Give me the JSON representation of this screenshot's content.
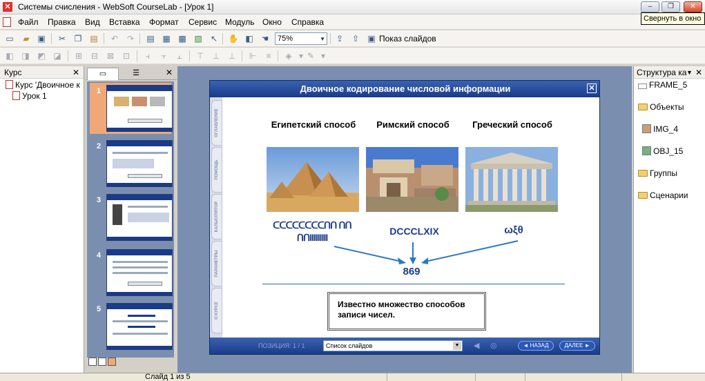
{
  "window": {
    "title": "Системы счисления - WebSoft CourseLab - [Урок 1]",
    "minimize": "–",
    "restore": "❐",
    "close": "✕",
    "tooltip": "Свернуть в окно"
  },
  "menu": [
    "Файл",
    "Правка",
    "Вид",
    "Вставка",
    "Формат",
    "Сервис",
    "Модуль",
    "Окно",
    "Справка"
  ],
  "toolbar": {
    "zoom": "75%",
    "show_slides": "Показ слайдов"
  },
  "course_panel": {
    "title": "Курс",
    "tree": [
      "Курс 'Двоичное к",
      "Урок 1"
    ]
  },
  "slides_panel": {
    "slides": [
      "1",
      "2",
      "3",
      "4",
      "5"
    ]
  },
  "slide": {
    "title": "Двоичное кодирование числовой информации",
    "side_tabs": [
      "ОГЛАВЛЕНИЕ",
      "ПОМОЩЬ",
      "КАЛЬКУЛЯТОР",
      "ПАРАМЕТРЫ",
      "О КУРСЕ"
    ],
    "columns": [
      {
        "heading": "Египетский способ",
        "numeral": "ᑕᑕᑕᑕᑕᑕᑕᑕᑎᑎ ᑎᑎᑎᑎIIIIIIIII"
      },
      {
        "heading": "Римский способ",
        "numeral": "DCCCLXIX"
      },
      {
        "heading": "Греческий способ",
        "numeral": "ωξθ"
      }
    ],
    "result": "869",
    "note": "Известно множество способов записи чисел.",
    "footer": {
      "position": "ПОЗИЦИЯ: 1 / 1",
      "slide_list": "Список слайдов",
      "back": "◄ НАЗАД",
      "next": "ДАЛЕЕ ►"
    }
  },
  "structure_panel": {
    "title": "Структура ка",
    "items": [
      "FRAME_5",
      "Объекты",
      "IMG_4",
      "OBJ_15",
      "Группы",
      "Сценарии"
    ]
  },
  "status": {
    "text": "Слайд 1 из 5"
  }
}
